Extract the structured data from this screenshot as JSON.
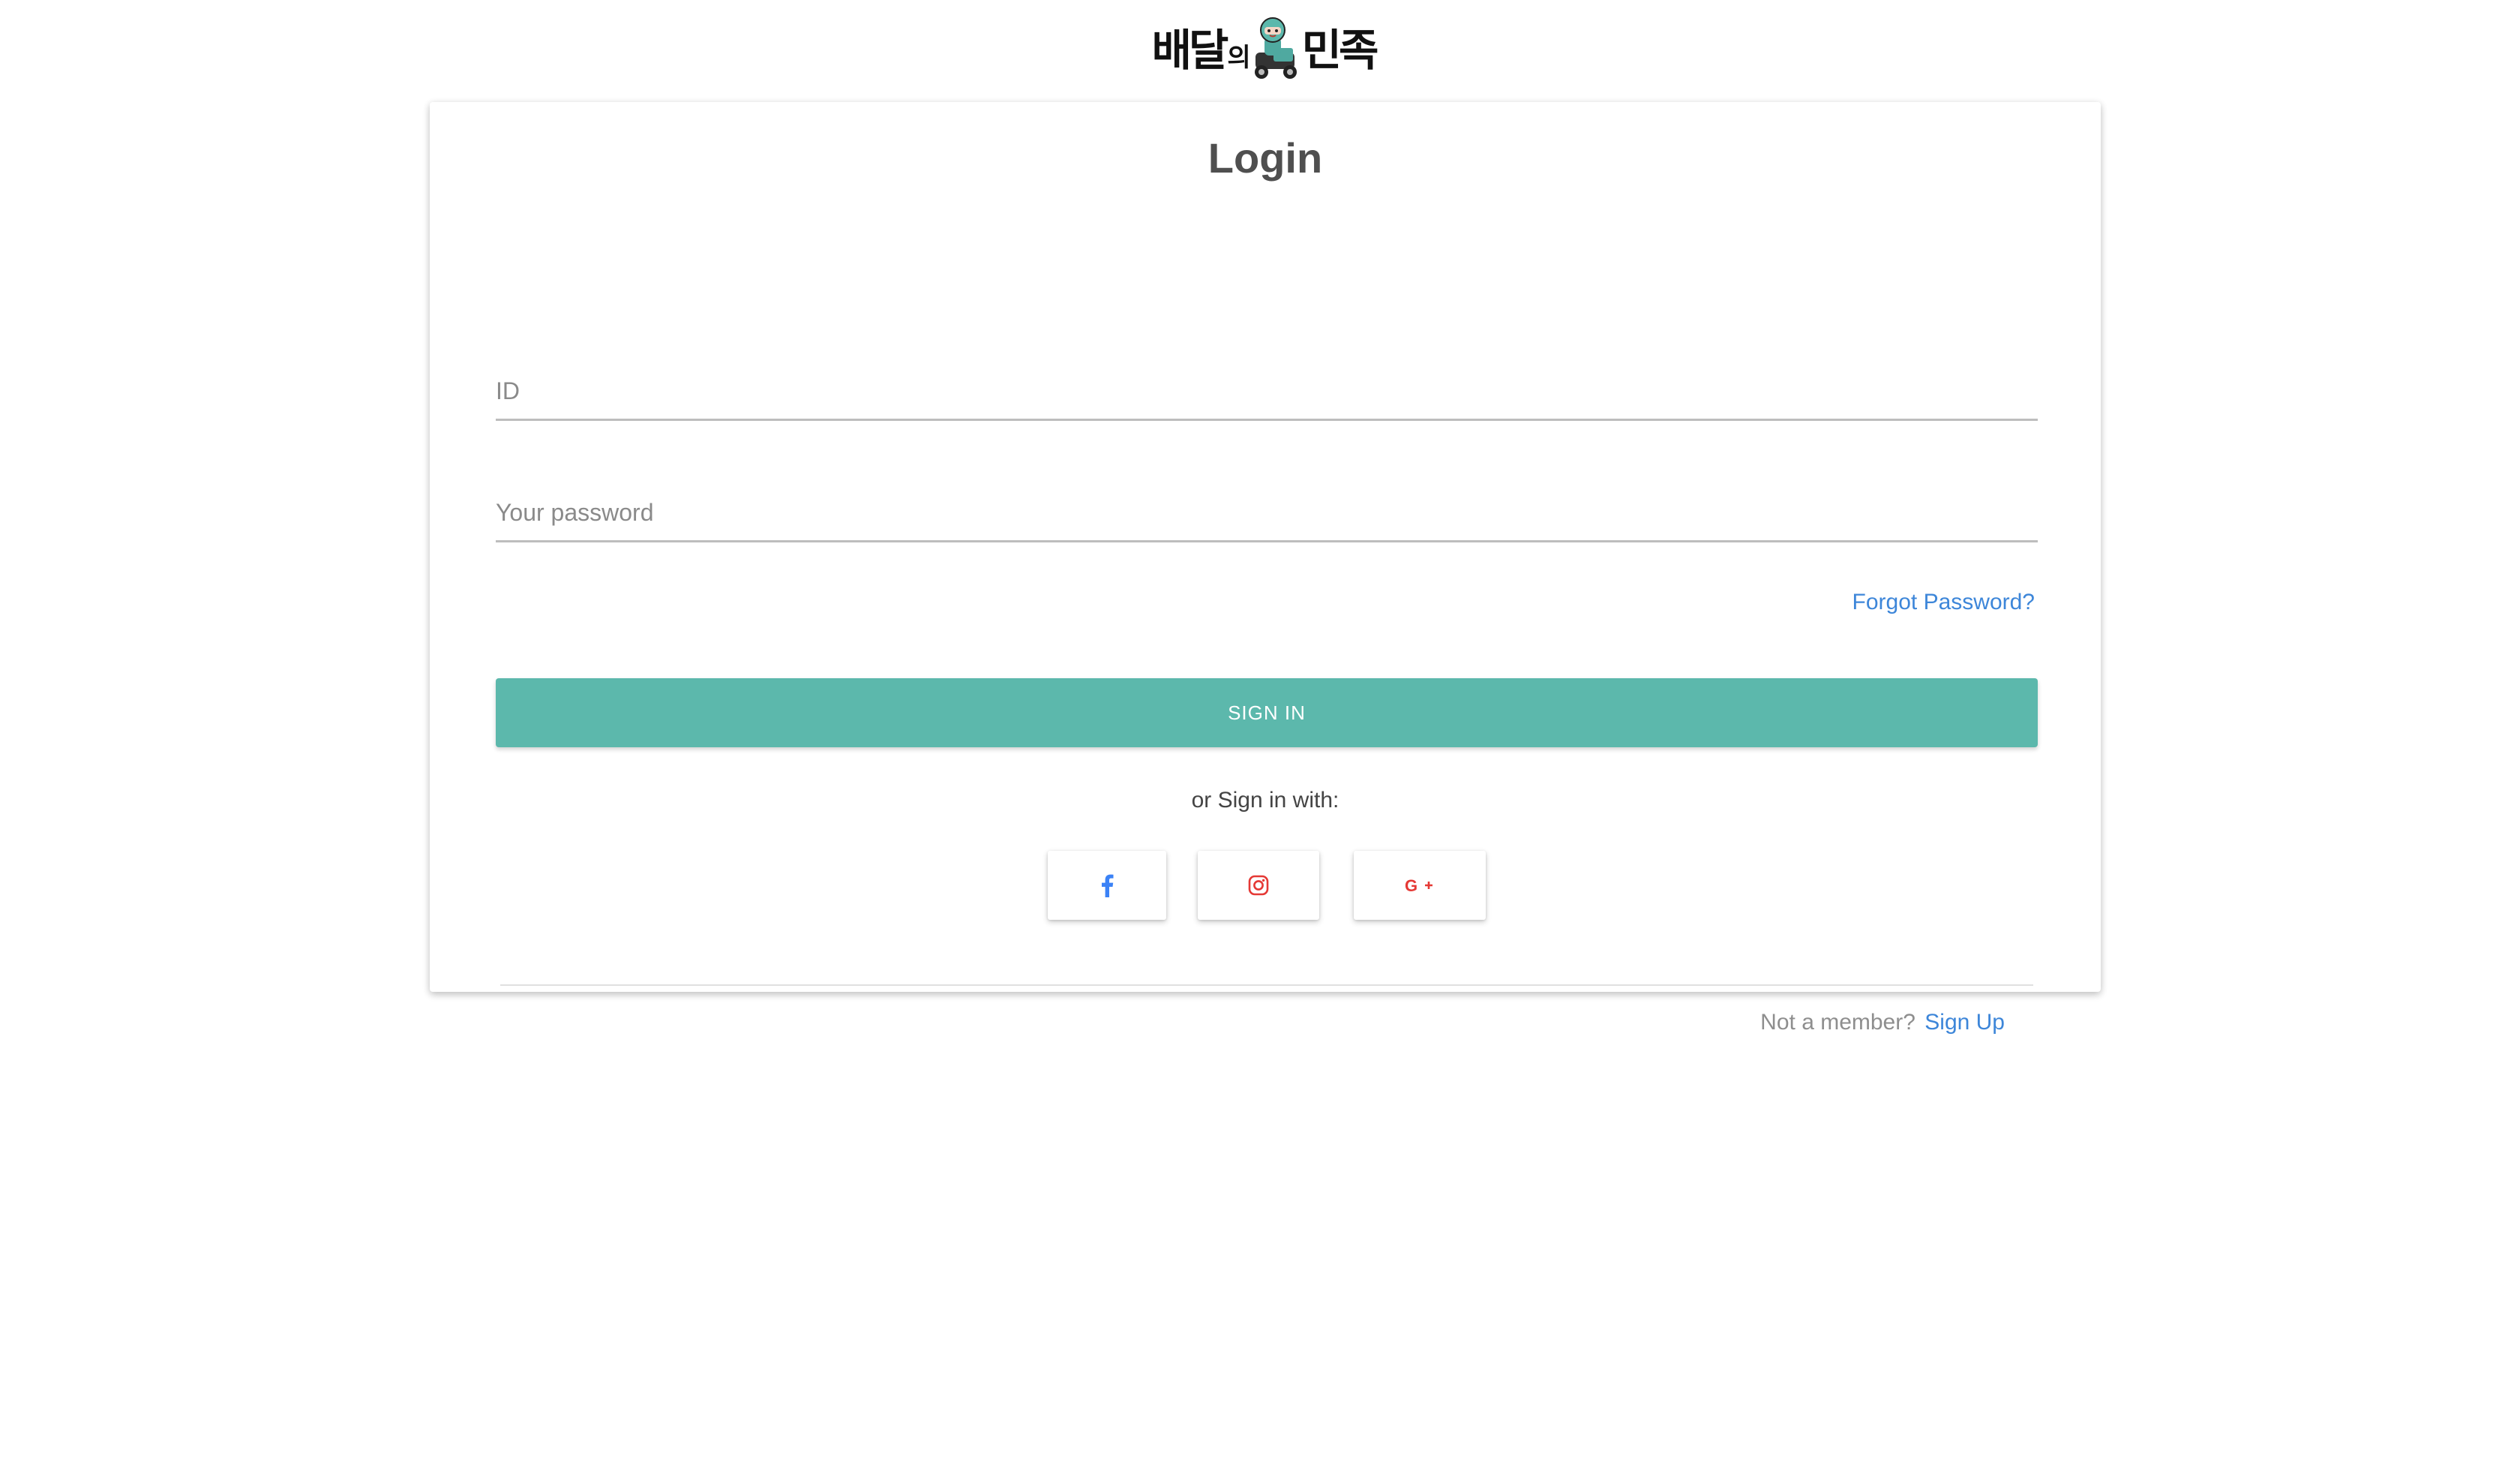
{
  "logo": {
    "part1": "배달의",
    "part1_main": "배달",
    "part1_small": "의",
    "part2": "민족"
  },
  "login": {
    "title": "Login",
    "id_placeholder": "ID",
    "password_placeholder": "Your password",
    "forgot_password": "Forgot Password?",
    "sign_in_button": "SIGN IN",
    "social_prompt": "or Sign in with:",
    "social_buttons": [
      {
        "name": "facebook",
        "icon": "facebook-icon",
        "color": "#3b82f6"
      },
      {
        "name": "instagram",
        "icon": "instagram-icon",
        "color": "#e53935"
      },
      {
        "name": "google-plus",
        "icon": "google-plus-icon",
        "color": "#e53935"
      }
    ],
    "footer_text": "Not a member?",
    "sign_up_link": "Sign Up"
  },
  "colors": {
    "accent": "#5cb8ac",
    "link": "#3d86d9"
  }
}
